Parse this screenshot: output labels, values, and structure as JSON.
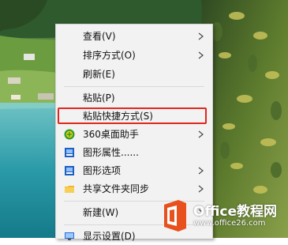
{
  "menu": {
    "items": [
      {
        "label": "查看(V)",
        "submenu": true,
        "icon": null
      },
      {
        "label": "排序方式(O)",
        "submenu": true,
        "icon": null
      },
      {
        "label": "刷新(E)",
        "submenu": false,
        "icon": null
      },
      {
        "label": "粘贴(P)",
        "submenu": false,
        "icon": null
      },
      {
        "label": "粘贴快捷方式(S)",
        "submenu": false,
        "icon": null
      },
      {
        "label": "360桌面助手",
        "submenu": true,
        "icon": "360-desktop-assistant-icon"
      },
      {
        "label": "图形属性......",
        "submenu": false,
        "icon": "graphics-properties-icon"
      },
      {
        "label": "图形选项",
        "submenu": true,
        "icon": "graphics-options-icon"
      },
      {
        "label": "共享文件夹同步",
        "submenu": true,
        "icon": "shared-folder-sync-icon"
      },
      {
        "label": "新建(W)",
        "submenu": true,
        "icon": null
      },
      {
        "label": "显示设置(D)",
        "submenu": false,
        "icon": "display-settings-icon"
      }
    ]
  },
  "highlight": {
    "target_label": "粘贴快捷方式(S)",
    "color": "#e0271f"
  },
  "watermark": {
    "brand": "Office教程网",
    "url": "www.office26.com",
    "logo_color": "#e8501e"
  }
}
